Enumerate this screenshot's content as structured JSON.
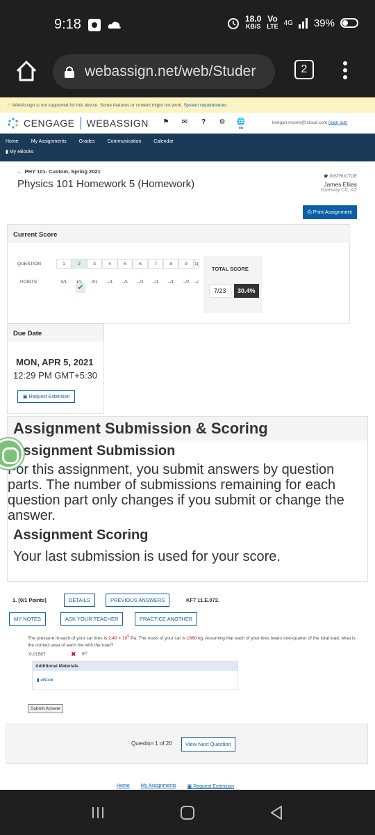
{
  "status": {
    "time": "9:18",
    "speed": "18.0",
    "speed_unit": "KB/S",
    "net": "4G",
    "lte": "LTE",
    "volte": "Vo",
    "battery": "39%"
  },
  "browser": {
    "url": "webassign.net/web/Studer",
    "tab_count": "2"
  },
  "warning": {
    "text": "WebAssign is not supported for this device. Some features or content might not work.",
    "link": "System requirements"
  },
  "brand": {
    "cengage": "CENGAGE",
    "webassign": "WEBASSIGN",
    "user_email": "keegan.moore@icloud.com",
    "signout": "(sign out)",
    "lang": "EN"
  },
  "nav": {
    "items": [
      "Home",
      "My Assignments",
      "Grades",
      "Communication",
      "Calendar"
    ],
    "ebooks": "My eBooks"
  },
  "course": {
    "crumb": "PHY 101- Custom, Spring 2021",
    "title": "Physics 101 Homework 5 (Homework)"
  },
  "instructor": {
    "label": "INSTRUCTOR",
    "name": "James Ellias",
    "school": "Gateway CC, AZ"
  },
  "print_button": "Print Assignment",
  "score": {
    "header": "Current Score",
    "question_label": "QUESTION",
    "points_label": "POINTS",
    "questions": [
      "1",
      "2",
      "3",
      "4",
      "5",
      "6",
      "7",
      "8",
      "9",
      "1("
    ],
    "points": [
      "0/1",
      "1/1",
      "0/1",
      "–/1",
      "–/1",
      "–/2",
      "–/1",
      "–/1",
      "–/2",
      "–/"
    ],
    "total_label": "TOTAL SCORE",
    "total_value": "7/23",
    "total_pct": "30.4%"
  },
  "due": {
    "header": "Due Date",
    "date": "MON, APR 5, 2021",
    "time": "12:29 PM GMT+5:30",
    "extension": "Request Extension"
  },
  "submission": {
    "heading": "Assignment Submission & Scoring",
    "sub_heading": "Assignment Submission",
    "sub_text": "For this assignment, you submit answers by question parts. The number of submissions remaining for each question part only changes if you submit or change the answer.",
    "scoring_heading": "Assignment Scoring",
    "scoring_text": "Your last submission is used for your score."
  },
  "question": {
    "number_points": "1.  [0/1 Points]",
    "details": "DETAILS",
    "previous": "PREVIOUS ANSWERS",
    "code": "KF7 11.E.072.",
    "my_notes": "MY NOTES",
    "ask": "ASK YOUR TEACHER",
    "practice": "PRACTICE ANOTHER",
    "text_a": "The pressure in each of your car tires is ",
    "pressure": "2.40 × 10",
    "pressure_exp": "5",
    "text_b": " Pa. The mass of your car is ",
    "mass": "1660",
    "text_c": " kg. Assuming that each of your tires bears one-quarter of the total load, what is the contact area of each tire with the road?",
    "answer": "0.01587",
    "unit": "m²",
    "additional": "Additional Materials",
    "ebook": "eBook",
    "submit": "Submit Answer"
  },
  "pager": {
    "label": "Question 1 of 20",
    "next": "View Next Question"
  },
  "footer": {
    "links": [
      "Home",
      "My Assignments",
      "Request Extension"
    ]
  }
}
